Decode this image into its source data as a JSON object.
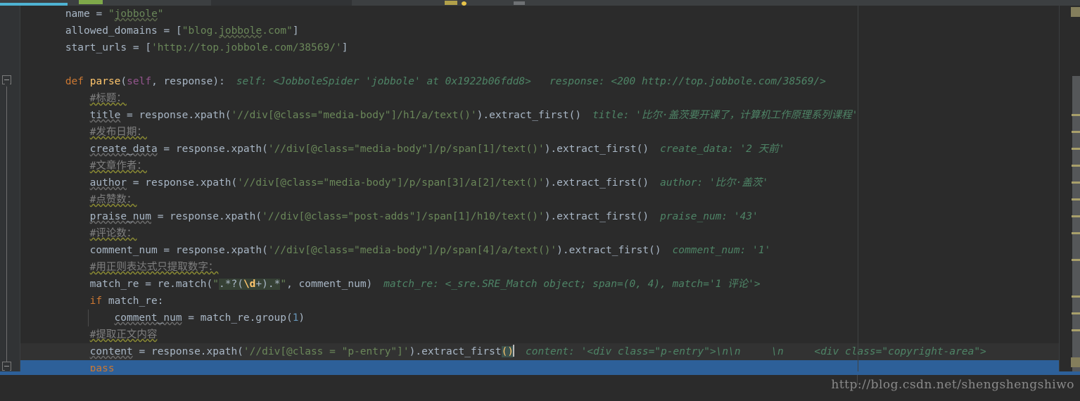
{
  "app": {
    "kind": "code-editor",
    "theme": "darcula",
    "background": "#2b2b2b",
    "gutter_background": "#313335",
    "selection_color": "#2d6099",
    "accent_tab": "#4eb3d3"
  },
  "tabstrip": {
    "active_tab_underline_color": "#4eb3d3",
    "icons": [
      "run-icon-green",
      "warning-icon-yellow",
      "tool-icon-grey"
    ]
  },
  "gutter": {
    "fold_markers": [
      {
        "name": "fold-marker-def-parse",
        "label": "−"
      },
      {
        "name": "fold-marker-pass",
        "label": "−"
      }
    ]
  },
  "editor": {
    "right_margin_guide_x": 1190,
    "caret_line_index": 21,
    "lines": [
      {
        "n": 1,
        "indent": 4,
        "tokens": [
          {
            "t": "name ",
            "c": "plain"
          },
          {
            "t": "= ",
            "c": "plain"
          },
          {
            "t": "\"",
            "c": "str"
          },
          {
            "t": "jobbole",
            "c": "str typo-u-str"
          },
          {
            "t": "\"",
            "c": "str"
          }
        ],
        "hint": ""
      },
      {
        "n": 2,
        "indent": 4,
        "tokens": [
          {
            "t": "allowed_domains ",
            "c": "plain"
          },
          {
            "t": "= [",
            "c": "plain"
          },
          {
            "t": "\"blog.",
            "c": "str"
          },
          {
            "t": "jobbole",
            "c": "str typo-u-str"
          },
          {
            "t": ".com\"",
            "c": "str"
          },
          {
            "t": "]",
            "c": "plain"
          }
        ],
        "hint": ""
      },
      {
        "n": 3,
        "indent": 4,
        "tokens": [
          {
            "t": "start_urls ",
            "c": "plain"
          },
          {
            "t": "= [",
            "c": "plain"
          },
          {
            "t": "'http://top.jobbole.com/38569/'",
            "c": "str"
          },
          {
            "t": "]",
            "c": "plain"
          }
        ],
        "hint": ""
      },
      {
        "n": 4,
        "indent": 0,
        "tokens": [],
        "hint": ""
      },
      {
        "n": 5,
        "indent": 4,
        "tokens": [
          {
            "t": "def ",
            "c": "kw"
          },
          {
            "t": "parse",
            "c": "fn"
          },
          {
            "t": "(",
            "c": "plain"
          },
          {
            "t": "self",
            "c": "selfkw"
          },
          {
            "t": ", response):",
            "c": "plain"
          }
        ],
        "hint": "self: <JobboleSpider 'jobbole' at 0x1922b06fdd8>   response: <200 http://top.jobbole.com/38569/>"
      },
      {
        "n": 6,
        "indent": 8,
        "tokens": [
          {
            "t": "#标题：",
            "c": "comment comment-u"
          }
        ],
        "hint": ""
      },
      {
        "n": 7,
        "indent": 8,
        "tokens": [
          {
            "t": "title",
            "c": "plain typo-u"
          },
          {
            "t": " = response.xpath(",
            "c": "plain"
          },
          {
            "t": "'//div[@class=\"media-body\"]/h1/a/text()'",
            "c": "str"
          },
          {
            "t": ").extract_first()",
            "c": "plain"
          }
        ],
        "hint": "title: '比尔·盖茨要开课了，计算机工作原理系列课程'"
      },
      {
        "n": 8,
        "indent": 8,
        "tokens": [
          {
            "t": "#发布日期：",
            "c": "comment comment-u"
          }
        ],
        "hint": ""
      },
      {
        "n": 9,
        "indent": 8,
        "tokens": [
          {
            "t": "create_data",
            "c": "plain typo-u"
          },
          {
            "t": " = response.xpath(",
            "c": "plain"
          },
          {
            "t": "'//div[@class=\"media-body\"]/p/span[1]/text()'",
            "c": "str"
          },
          {
            "t": ").extract_first()",
            "c": "plain"
          }
        ],
        "hint": "create_data: '2 天前'"
      },
      {
        "n": 10,
        "indent": 8,
        "tokens": [
          {
            "t": "#文章作者：",
            "c": "comment comment-u"
          }
        ],
        "hint": ""
      },
      {
        "n": 11,
        "indent": 8,
        "tokens": [
          {
            "t": "author",
            "c": "plain typo-u"
          },
          {
            "t": " = response.xpath(",
            "c": "plain"
          },
          {
            "t": "'//div[@class=\"media-body\"]/p/span[3]/a[2]/text()'",
            "c": "str"
          },
          {
            "t": ").extract_first()",
            "c": "plain"
          }
        ],
        "hint": "author: '比尔·盖茨'"
      },
      {
        "n": 12,
        "indent": 8,
        "tokens": [
          {
            "t": "#点赞数：",
            "c": "comment comment-u"
          }
        ],
        "hint": ""
      },
      {
        "n": 13,
        "indent": 8,
        "tokens": [
          {
            "t": "praise_num",
            "c": "plain typo-u"
          },
          {
            "t": " = response.xpath(",
            "c": "plain"
          },
          {
            "t": "'//div[@class=\"post-adds\"]/span[1]/h10/text()'",
            "c": "str"
          },
          {
            "t": ").extract_first()",
            "c": "plain"
          }
        ],
        "hint": "praise_num: '43'"
      },
      {
        "n": 14,
        "indent": 8,
        "tokens": [
          {
            "t": "#评论数：",
            "c": "comment comment-u"
          }
        ],
        "hint": ""
      },
      {
        "n": 15,
        "indent": 8,
        "tokens": [
          {
            "t": "comment_num = response.xpath(",
            "c": "plain"
          },
          {
            "t": "'//div[@class=\"media-body\"]/p/span[4]/a/text()'",
            "c": "str"
          },
          {
            "t": ").extract_first()",
            "c": "plain"
          }
        ],
        "hint": "comment_num: '1'"
      },
      {
        "n": 16,
        "indent": 8,
        "tokens": [
          {
            "t": "#用正则表达式只提取数字：",
            "c": "comment comment-u"
          }
        ],
        "hint": ""
      },
      {
        "n": 17,
        "indent": 8,
        "tokens": [
          {
            "t": "match_re = re.match(",
            "c": "plain"
          },
          {
            "t": "\"",
            "c": "str"
          },
          {
            "t": ".*?(",
            "c": "plain strhl"
          },
          {
            "t": "\\d",
            "c": "regexesc strhl"
          },
          {
            "t": "+).*",
            "c": "plain strhl"
          },
          {
            "t": "\"",
            "c": "str"
          },
          {
            "t": ", comment_num)",
            "c": "plain"
          }
        ],
        "hint": "match_re: <_sre.SRE_Match object; span=(0, 4), match='1 评论'>"
      },
      {
        "n": 18,
        "indent": 8,
        "tokens": [
          {
            "t": "if ",
            "c": "kw"
          },
          {
            "t": "match_re:",
            "c": "plain"
          }
        ],
        "hint": ""
      },
      {
        "n": 19,
        "indent": 12,
        "tokens": [
          {
            "t": "comment_num",
            "c": "plain typo-u"
          },
          {
            "t": " = match_re.group(",
            "c": "plain"
          },
          {
            "t": "1",
            "c": "num"
          },
          {
            "t": ")",
            "c": "plain"
          }
        ],
        "hint": ""
      },
      {
        "n": 20,
        "indent": 8,
        "tokens": [
          {
            "t": "#提取正文内容",
            "c": "comment comment-u"
          }
        ],
        "hint": ""
      },
      {
        "n": 21,
        "indent": 8,
        "tokens": [
          {
            "t": "content",
            "c": "plain typo-u"
          },
          {
            "t": " = response.xpath(",
            "c": "plain"
          },
          {
            "t": "'//div[@class = \"p-entry\"]'",
            "c": "str"
          },
          {
            "t": ").extract_first",
            "c": "plain"
          },
          {
            "t": "()",
            "c": "brackethl"
          }
        ],
        "hint": "content: '<div class=\"p-entry\">\\n\\n     \\n     <div class=\"copyright-area\">",
        "caret_after": true
      },
      {
        "n": 22,
        "indent": 8,
        "tokens": [
          {
            "t": "pass",
            "c": "kw"
          }
        ],
        "hint": "",
        "selected": true
      }
    ]
  },
  "stripe": {
    "marker_color": "#a9a06b",
    "block_color": "#847e5c",
    "scrollbar_thumb_color": "#555759"
  },
  "watermark": {
    "text": "http://blog.csdn.net/shengshengshiwo"
  }
}
